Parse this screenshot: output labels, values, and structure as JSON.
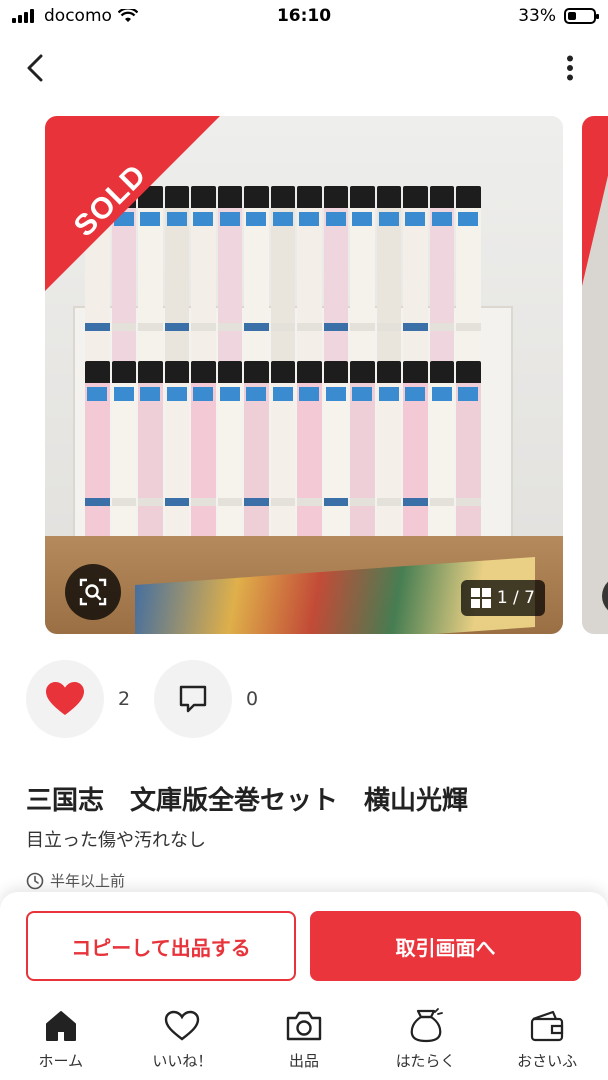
{
  "status_bar": {
    "carrier": "docomo",
    "time": "16:10",
    "battery": "33%",
    "battery_level": 0.33
  },
  "listing": {
    "sold_label": "SOLD",
    "image_counter": "1 / 7",
    "likes_count": "2",
    "comments_count": "0",
    "title": "三国志　文庫版全巻セット　横山光輝",
    "description": "目立った傷や汚れなし",
    "posted": "半年以上前"
  },
  "cta": {
    "copy_listing": "コピーして出品する",
    "transaction": "取引画面へ"
  },
  "tabs": [
    {
      "label": "ホーム",
      "icon": "home-icon",
      "active": true
    },
    {
      "label": "いいね！",
      "icon": "heart-icon"
    },
    {
      "label": "出品",
      "icon": "camera-icon"
    },
    {
      "label": "はたらく",
      "icon": "money-bag-icon"
    },
    {
      "label": "おさいふ",
      "icon": "wallet-icon"
    }
  ],
  "colors": {
    "brand_red": "#ea353d",
    "sold_red": "#e8333a",
    "text": "#222222"
  }
}
